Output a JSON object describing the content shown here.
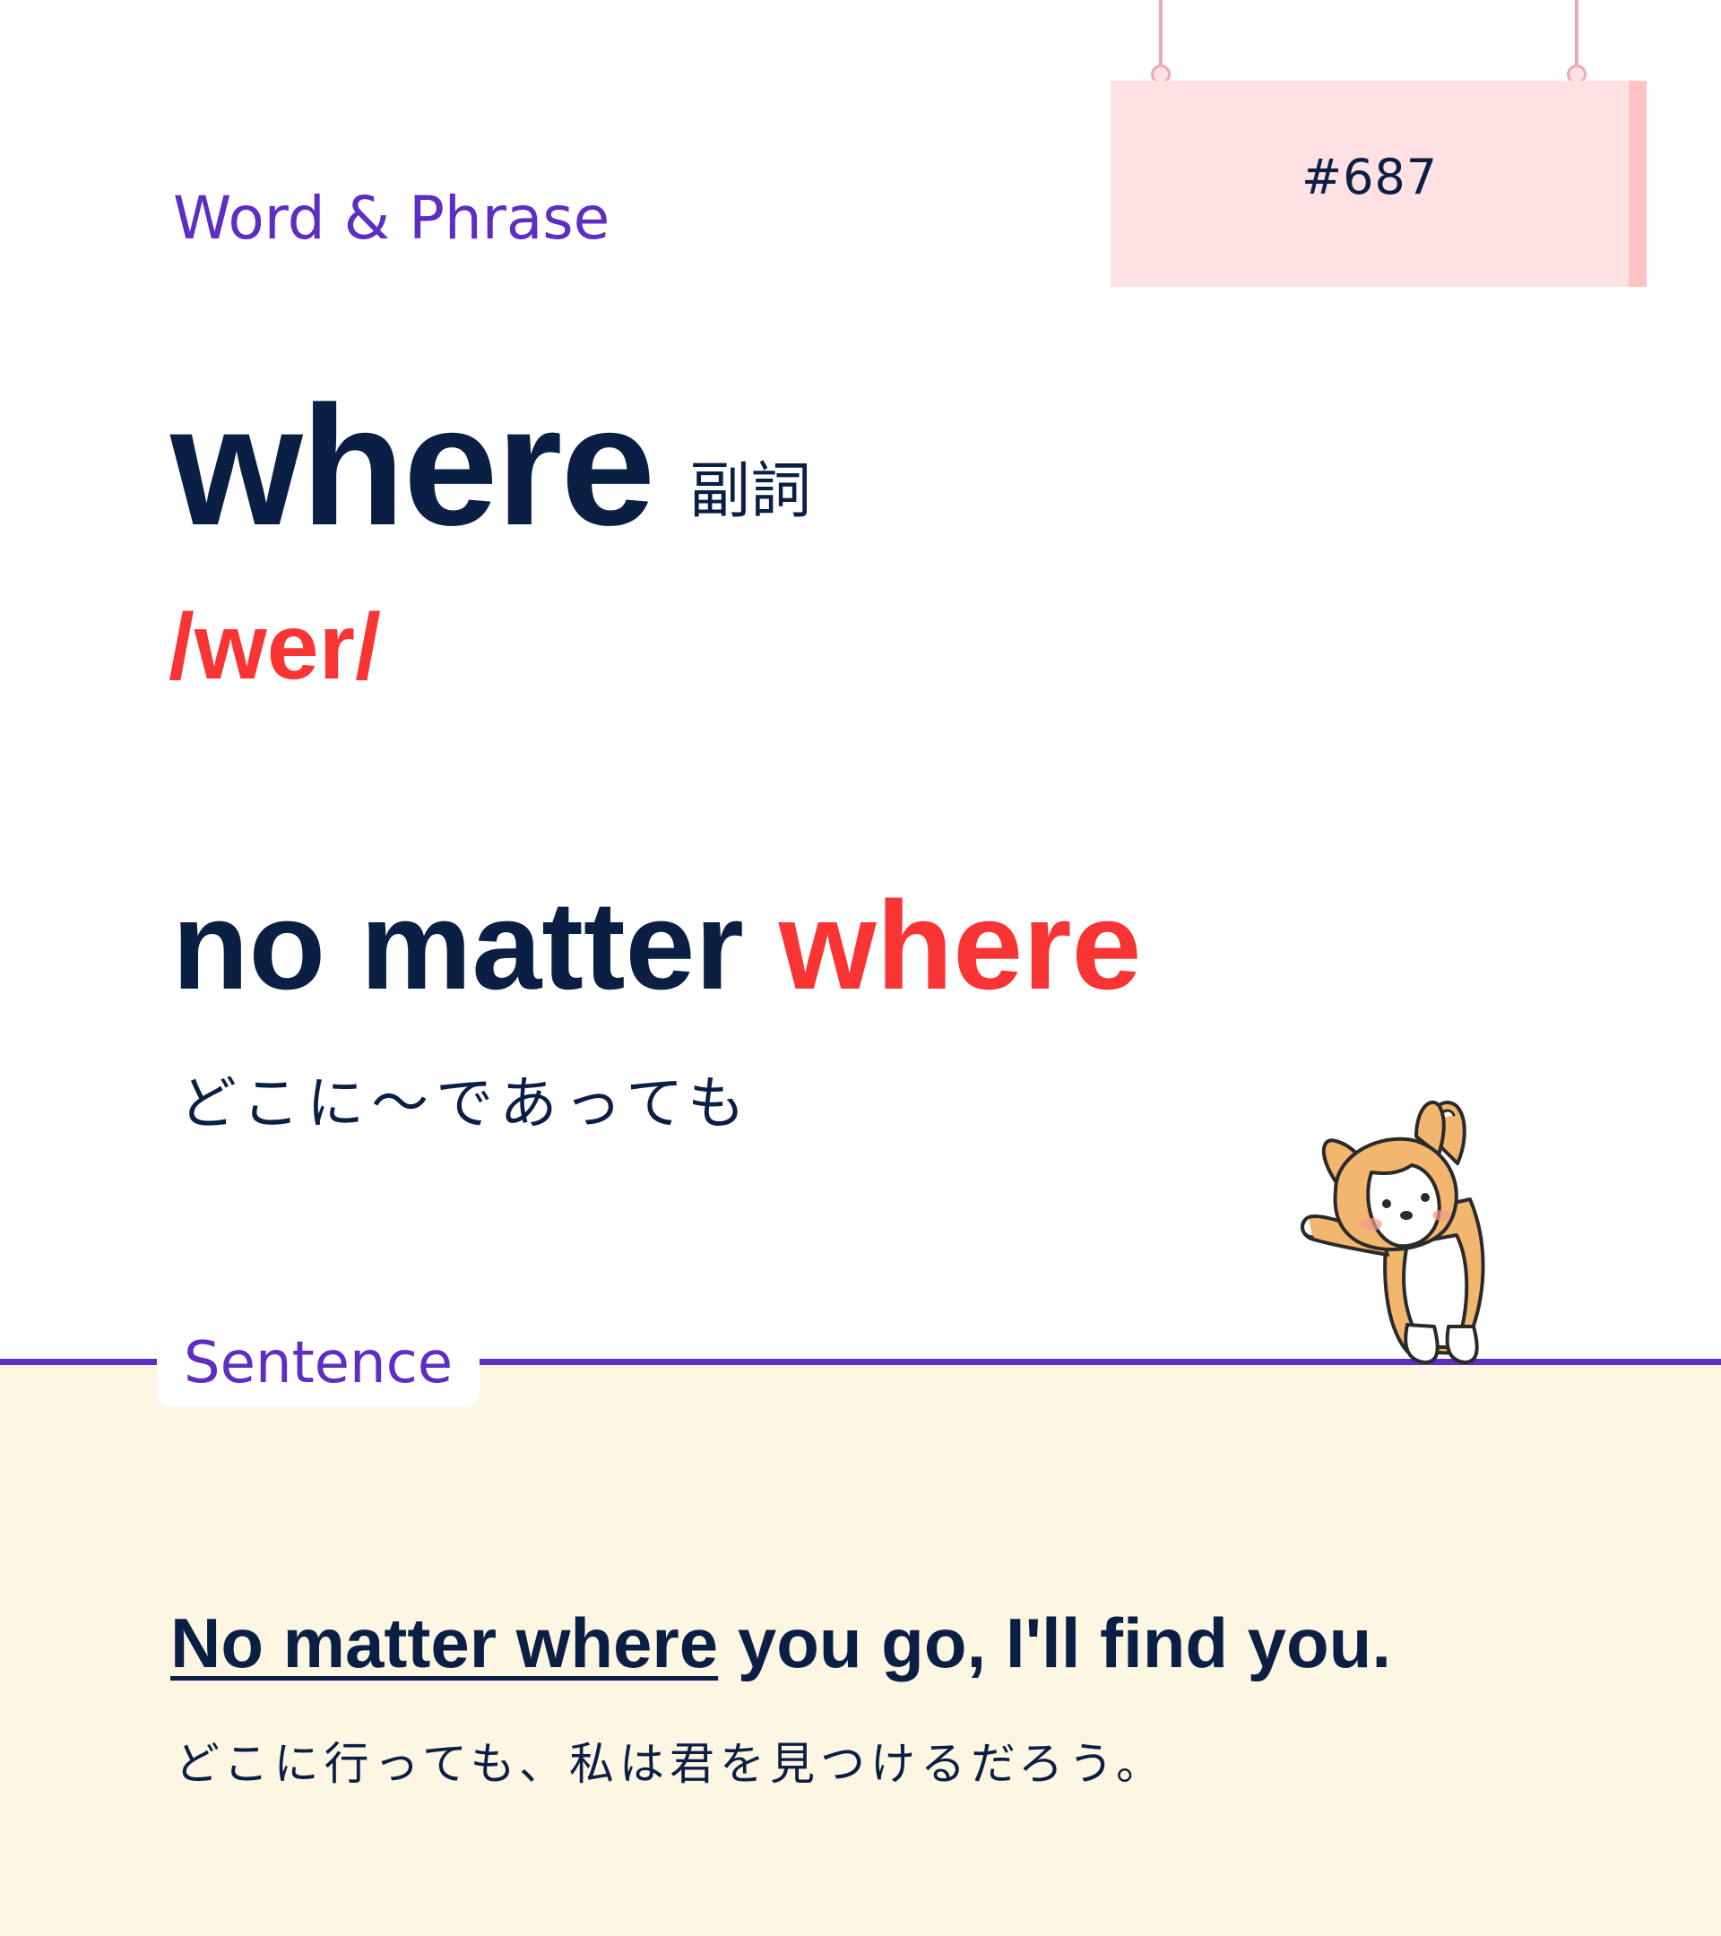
{
  "card": {
    "category": "Word & Phrase",
    "number": "#687",
    "word": "where",
    "part_of_speech": "副詞",
    "pronunciation": "/wer/",
    "section_label": "Sentence"
  },
  "phrase": {
    "prefix": "no matter",
    "highlight": "where",
    "translation": "どこに～であっても"
  },
  "example": {
    "target": "No matter where",
    "rest": "you go, I'll find you.",
    "translation": "どこに行っても、私は君を見つけるだろう。"
  },
  "colors": {
    "navy": "#0b1f44",
    "accent_red": "#f83434",
    "purple": "#5e2dc1",
    "sign_pink": "#ffe1e4",
    "panel_cream": "#fdf6e3"
  },
  "icons": [
    "corgi-mascot-icon",
    "hanging-sign-hook-icon"
  ]
}
